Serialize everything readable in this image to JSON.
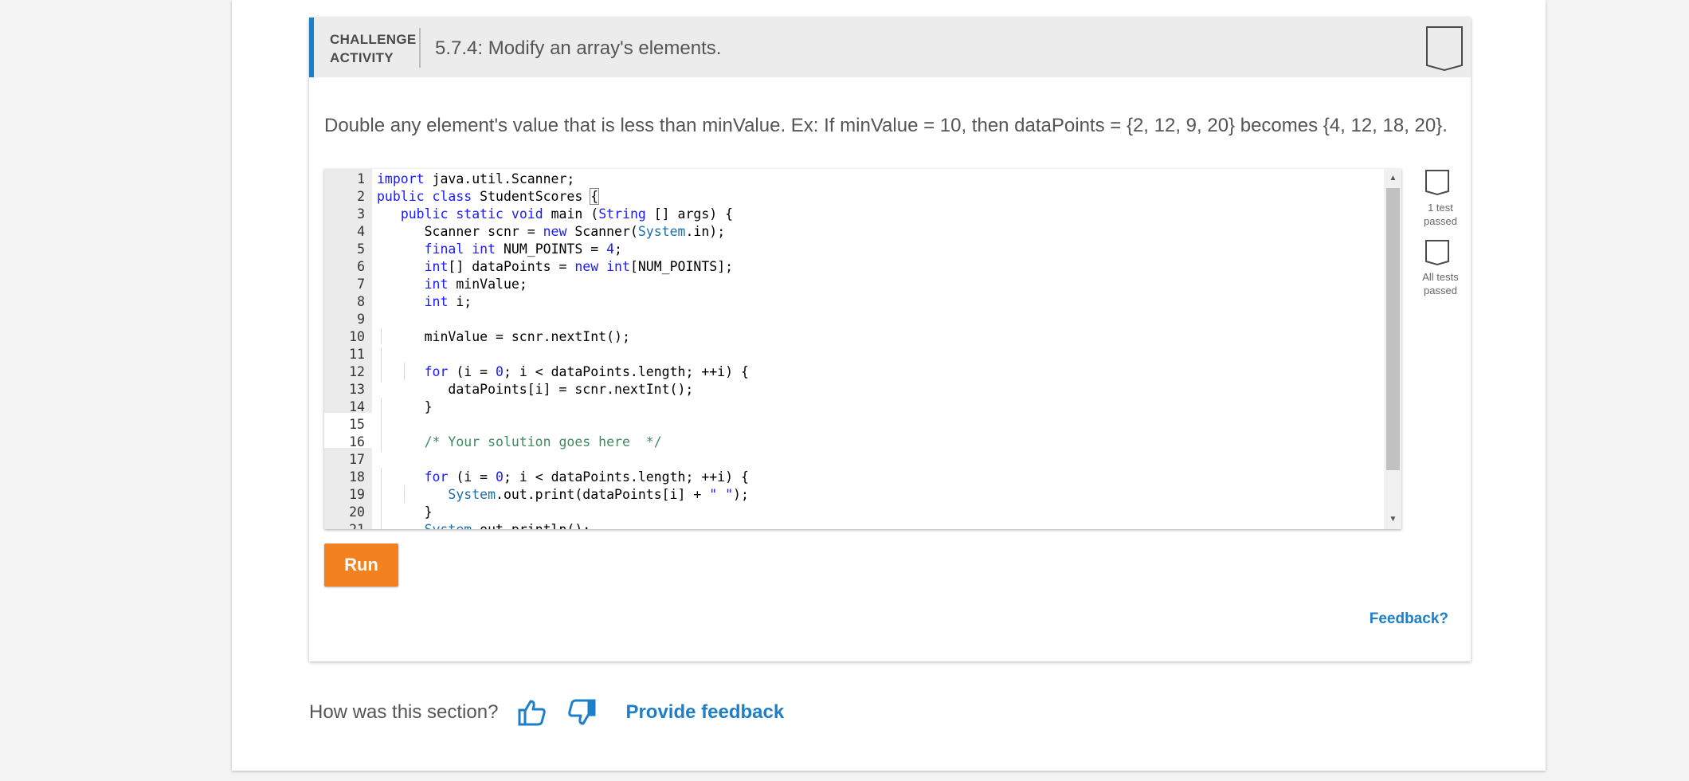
{
  "activity": {
    "badge_line1": "CHALLENGE",
    "badge_line2": "ACTIVITY",
    "title": "5.7.4: Modify an array's elements.",
    "prompt": "Double any element's value that is less than minValue. Ex: If minValue = 10, then dataPoints = {2, 12, 9, 20} becomes {4, 12, 18, 20}.",
    "accent_color": "#1d7fc7"
  },
  "editor": {
    "line_numbers": [
      "1",
      "2",
      "3",
      "4",
      "5",
      "6",
      "7",
      "8",
      "9",
      "10",
      "11",
      "12",
      "13",
      "14",
      "15",
      "16",
      "17",
      "18",
      "19",
      "20",
      "21"
    ]
  },
  "tests": {
    "one_test_line1": "1 test",
    "one_test_line2": "passed",
    "all_tests_line1": "All tests",
    "all_tests_line2": "passed"
  },
  "run_label": "Run",
  "feedback_link": "Feedback?",
  "rating": {
    "question": "How was this section?",
    "provide_feedback": "Provide feedback",
    "thumbs_up_icon": "thumbs-up-icon",
    "thumbs_down_icon": "thumbs-down-icon"
  },
  "colors": {
    "run_button": "#f48120",
    "link": "#1d7fc7"
  }
}
